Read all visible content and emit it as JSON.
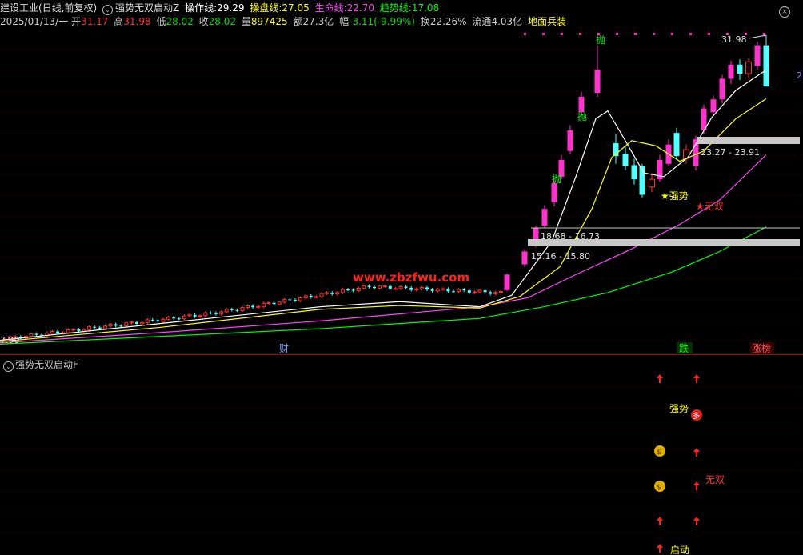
{
  "header": {
    "stock_name": "建设工业",
    "mode": "(日线,前复权)",
    "indicator": "强势无双启动Z",
    "values": [
      {
        "label": "操作线:",
        "value": "29.29",
        "color": "#ffffff"
      },
      {
        "label": "操盘线:",
        "value": "27.05",
        "color": "#ffff00"
      },
      {
        "label": "生命线:",
        "value": "22.70",
        "color": "#ff44ff"
      },
      {
        "label": "趋势线:",
        "value": "17.08",
        "color": "#00ff00"
      }
    ]
  },
  "quote": {
    "date": "2025/01/13/一",
    "open_label": "开",
    "open": "31.17",
    "high_label": "高",
    "high": "31.98",
    "low_label": "低",
    "low": "28.02",
    "close_label": "收",
    "close": "28.02",
    "volume_label": "量",
    "volume": "897425",
    "amount_label": "额",
    "amount": "27.3亿",
    "change_label": "幅",
    "change": "-3.11(-9.99%)",
    "turnover_label": "换",
    "turnover": "22.26%",
    "float_label": "流通",
    "float": "4.03亿",
    "tag": "地面兵装"
  },
  "chart_labels": {
    "high_price": "31.98",
    "low_price": "7.90",
    "zone_upper": "23.27 - 23.91",
    "zone_mid": "18.68 - 16.73",
    "zone_low": "15.16 - 15.80",
    "sell_1": "抛",
    "sell_2": "抛",
    "sell_3": "抛",
    "strong": "★强势",
    "wushuang": "★无双",
    "watermark": "www.zbzfwu.com",
    "cai": "财",
    "die": "跌",
    "zhangbang": "涨榜",
    "right_edge": "2"
  },
  "sub_indicator": {
    "title": "强势无双启动F",
    "strong": "强势",
    "wushuang": "无双",
    "qidong": "启动",
    "sell_badge": "多"
  },
  "colors": {
    "up": "#ff3232",
    "down": "#54ffff",
    "limit_up": "#ff33cc",
    "operate_line": "#ffffff",
    "trade_line": "#ffff00",
    "life_line": "#ff44ff",
    "trend_line": "#00ff00"
  }
}
